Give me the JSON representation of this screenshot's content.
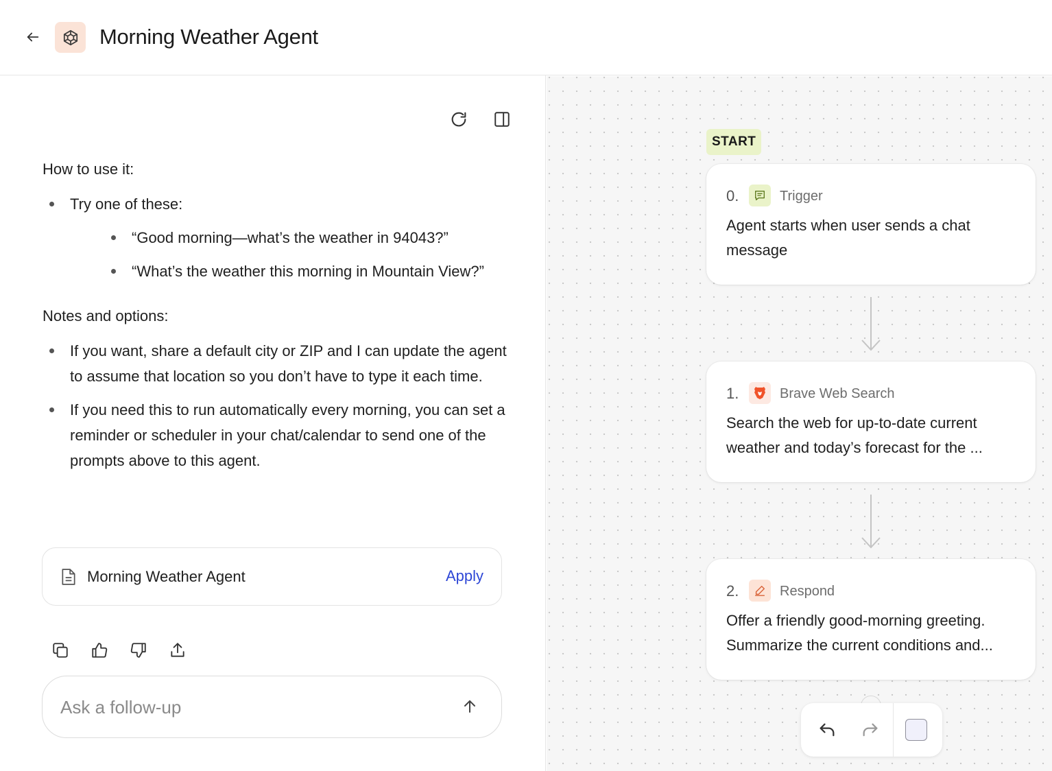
{
  "header": {
    "title": "Morning Weather Agent",
    "back_icon": "arrow-left-icon",
    "app_icon": "agent-cube-icon",
    "app_icon_bg": "#fbe3d7",
    "app_icon_color": "#d9643a"
  },
  "chat": {
    "toolbar": {
      "refresh_icon": "refresh-icon",
      "panel_icon": "sidebar-panel-icon"
    },
    "message": {
      "how_heading": "How to use it:",
      "try_label": "Try one of these:",
      "examples": [
        "“Good morning—what’s the weather in 94043?”",
        "“What’s the weather this morning in Mountain View?”"
      ],
      "notes_heading": "Notes and options:",
      "notes": [
        "If you want, share a default city or ZIP and I can update the agent to assume that location so you don’t have to type it each time.",
        "If you need this to run automatically every morning, you can set a reminder or scheduler in your chat/calendar to send one of the prompts above to this agent."
      ]
    },
    "artifact": {
      "icon": "document-icon",
      "title": "Morning Weather Agent",
      "apply_label": "Apply",
      "apply_color": "#2e47d6"
    },
    "feedback_icons": [
      "copy-icon",
      "thumbs-up-icon",
      "thumbs-down-icon",
      "share-icon"
    ],
    "composer": {
      "placeholder": "Ask a follow-up",
      "value": "",
      "send_icon": "arrow-up-icon"
    }
  },
  "canvas": {
    "start_label": "START",
    "start_color": "#eaf3c9",
    "nodes": [
      {
        "number": "0.",
        "type": "Trigger",
        "icon": "chat-message-icon",
        "icon_bg": "#eaf3c9",
        "description": "Agent starts when user sends a chat message"
      },
      {
        "number": "1.",
        "type": "Brave Web Search",
        "icon": "brave-lion-icon",
        "icon_bg": "#fde9e2",
        "description": "Search the web for up-to-date current weather and today’s forecast for the ..."
      },
      {
        "number": "2.",
        "type": "Respond",
        "icon": "pen-icon",
        "icon_bg": "#fde3d6",
        "description": "Offer a friendly good-morning greeting. Summarize the current conditions and..."
      }
    ],
    "toolbar": {
      "undo_icon": "undo-icon",
      "redo_icon": "redo-icon",
      "color_icon": "color-swatch-icon"
    }
  }
}
